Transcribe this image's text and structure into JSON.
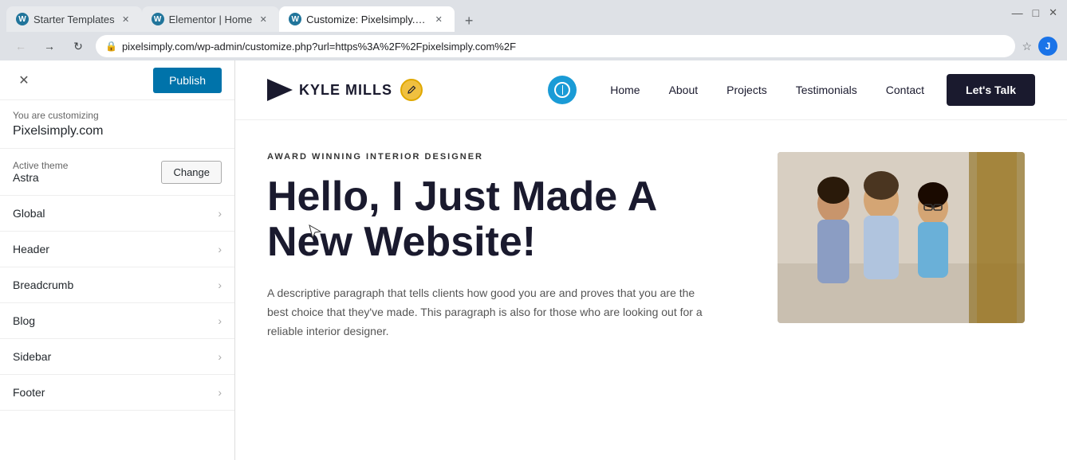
{
  "browser": {
    "tabs": [
      {
        "id": "tab1",
        "label": "Starter Templates",
        "icon": "WP",
        "active": false
      },
      {
        "id": "tab2",
        "label": "Elementor | Home",
        "icon": "WP",
        "active": false
      },
      {
        "id": "tab3",
        "label": "Customize: Pixelsimply.com",
        "icon": "WP",
        "active": true
      }
    ],
    "address": "pixelsimply.com/wp-admin/customize.php?url=https%3A%2F%2Fpixelsimply.com%2F",
    "window_controls": {
      "minimize": "—",
      "maximize": "□",
      "close": "✕"
    }
  },
  "customizer": {
    "close_label": "✕",
    "publish_label": "Publish",
    "customizing_text": "You are customizing",
    "site_name": "Pixelsimply.com",
    "active_theme_label": "Active theme",
    "theme_name": "Astra",
    "change_label": "Change",
    "nav_items": [
      {
        "label": "Global"
      },
      {
        "label": "Header"
      },
      {
        "label": "Breadcrumb"
      },
      {
        "label": "Blog"
      },
      {
        "label": "Sidebar"
      },
      {
        "label": "Footer"
      }
    ]
  },
  "site": {
    "logo_text": "KYLE MILLS",
    "nav_links": [
      {
        "label": "Home",
        "active": true
      },
      {
        "label": "About",
        "active": false
      },
      {
        "label": "Projects",
        "active": false
      },
      {
        "label": "Testimonials",
        "active": false
      },
      {
        "label": "Contact",
        "active": false
      }
    ],
    "cta_label": "Let's Talk",
    "hero": {
      "tag": "AWARD WINNING INTERIOR DESIGNER",
      "title_line1": "Hello, I Just Made A",
      "title_line2": "New Website!",
      "description": "A descriptive paragraph that tells clients how good you are and proves that you are the best choice that they've made. This paragraph is also for those who are looking out for a reliable interior designer."
    }
  }
}
